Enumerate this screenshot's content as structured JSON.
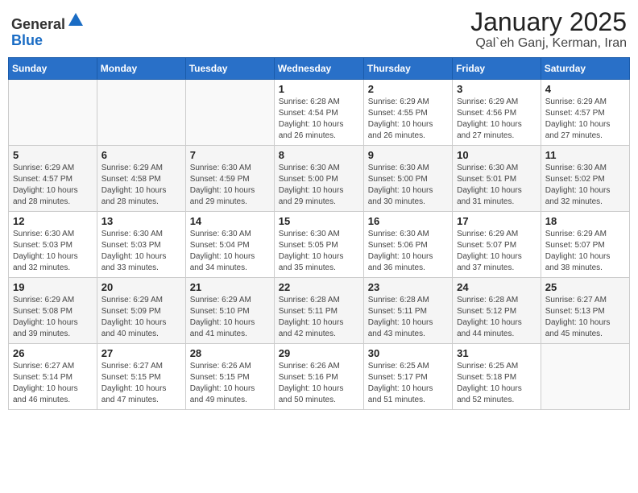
{
  "header": {
    "logo_general": "General",
    "logo_blue": "Blue",
    "month_title": "January 2025",
    "subtitle": "Qal`eh Ganj, Kerman, Iran"
  },
  "weekdays": [
    "Sunday",
    "Monday",
    "Tuesday",
    "Wednesday",
    "Thursday",
    "Friday",
    "Saturday"
  ],
  "weeks": [
    [
      {
        "day": "",
        "info": ""
      },
      {
        "day": "",
        "info": ""
      },
      {
        "day": "",
        "info": ""
      },
      {
        "day": "1",
        "info": "Sunrise: 6:28 AM\nSunset: 4:54 PM\nDaylight: 10 hours\nand 26 minutes."
      },
      {
        "day": "2",
        "info": "Sunrise: 6:29 AM\nSunset: 4:55 PM\nDaylight: 10 hours\nand 26 minutes."
      },
      {
        "day": "3",
        "info": "Sunrise: 6:29 AM\nSunset: 4:56 PM\nDaylight: 10 hours\nand 27 minutes."
      },
      {
        "day": "4",
        "info": "Sunrise: 6:29 AM\nSunset: 4:57 PM\nDaylight: 10 hours\nand 27 minutes."
      }
    ],
    [
      {
        "day": "5",
        "info": "Sunrise: 6:29 AM\nSunset: 4:57 PM\nDaylight: 10 hours\nand 28 minutes."
      },
      {
        "day": "6",
        "info": "Sunrise: 6:29 AM\nSunset: 4:58 PM\nDaylight: 10 hours\nand 28 minutes."
      },
      {
        "day": "7",
        "info": "Sunrise: 6:30 AM\nSunset: 4:59 PM\nDaylight: 10 hours\nand 29 minutes."
      },
      {
        "day": "8",
        "info": "Sunrise: 6:30 AM\nSunset: 5:00 PM\nDaylight: 10 hours\nand 29 minutes."
      },
      {
        "day": "9",
        "info": "Sunrise: 6:30 AM\nSunset: 5:00 PM\nDaylight: 10 hours\nand 30 minutes."
      },
      {
        "day": "10",
        "info": "Sunrise: 6:30 AM\nSunset: 5:01 PM\nDaylight: 10 hours\nand 31 minutes."
      },
      {
        "day": "11",
        "info": "Sunrise: 6:30 AM\nSunset: 5:02 PM\nDaylight: 10 hours\nand 32 minutes."
      }
    ],
    [
      {
        "day": "12",
        "info": "Sunrise: 6:30 AM\nSunset: 5:03 PM\nDaylight: 10 hours\nand 32 minutes."
      },
      {
        "day": "13",
        "info": "Sunrise: 6:30 AM\nSunset: 5:03 PM\nDaylight: 10 hours\nand 33 minutes."
      },
      {
        "day": "14",
        "info": "Sunrise: 6:30 AM\nSunset: 5:04 PM\nDaylight: 10 hours\nand 34 minutes."
      },
      {
        "day": "15",
        "info": "Sunrise: 6:30 AM\nSunset: 5:05 PM\nDaylight: 10 hours\nand 35 minutes."
      },
      {
        "day": "16",
        "info": "Sunrise: 6:30 AM\nSunset: 5:06 PM\nDaylight: 10 hours\nand 36 minutes."
      },
      {
        "day": "17",
        "info": "Sunrise: 6:29 AM\nSunset: 5:07 PM\nDaylight: 10 hours\nand 37 minutes."
      },
      {
        "day": "18",
        "info": "Sunrise: 6:29 AM\nSunset: 5:07 PM\nDaylight: 10 hours\nand 38 minutes."
      }
    ],
    [
      {
        "day": "19",
        "info": "Sunrise: 6:29 AM\nSunset: 5:08 PM\nDaylight: 10 hours\nand 39 minutes."
      },
      {
        "day": "20",
        "info": "Sunrise: 6:29 AM\nSunset: 5:09 PM\nDaylight: 10 hours\nand 40 minutes."
      },
      {
        "day": "21",
        "info": "Sunrise: 6:29 AM\nSunset: 5:10 PM\nDaylight: 10 hours\nand 41 minutes."
      },
      {
        "day": "22",
        "info": "Sunrise: 6:28 AM\nSunset: 5:11 PM\nDaylight: 10 hours\nand 42 minutes."
      },
      {
        "day": "23",
        "info": "Sunrise: 6:28 AM\nSunset: 5:11 PM\nDaylight: 10 hours\nand 43 minutes."
      },
      {
        "day": "24",
        "info": "Sunrise: 6:28 AM\nSunset: 5:12 PM\nDaylight: 10 hours\nand 44 minutes."
      },
      {
        "day": "25",
        "info": "Sunrise: 6:27 AM\nSunset: 5:13 PM\nDaylight: 10 hours\nand 45 minutes."
      }
    ],
    [
      {
        "day": "26",
        "info": "Sunrise: 6:27 AM\nSunset: 5:14 PM\nDaylight: 10 hours\nand 46 minutes."
      },
      {
        "day": "27",
        "info": "Sunrise: 6:27 AM\nSunset: 5:15 PM\nDaylight: 10 hours\nand 47 minutes."
      },
      {
        "day": "28",
        "info": "Sunrise: 6:26 AM\nSunset: 5:15 PM\nDaylight: 10 hours\nand 49 minutes."
      },
      {
        "day": "29",
        "info": "Sunrise: 6:26 AM\nSunset: 5:16 PM\nDaylight: 10 hours\nand 50 minutes."
      },
      {
        "day": "30",
        "info": "Sunrise: 6:25 AM\nSunset: 5:17 PM\nDaylight: 10 hours\nand 51 minutes."
      },
      {
        "day": "31",
        "info": "Sunrise: 6:25 AM\nSunset: 5:18 PM\nDaylight: 10 hours\nand 52 minutes."
      },
      {
        "day": "",
        "info": ""
      }
    ]
  ]
}
